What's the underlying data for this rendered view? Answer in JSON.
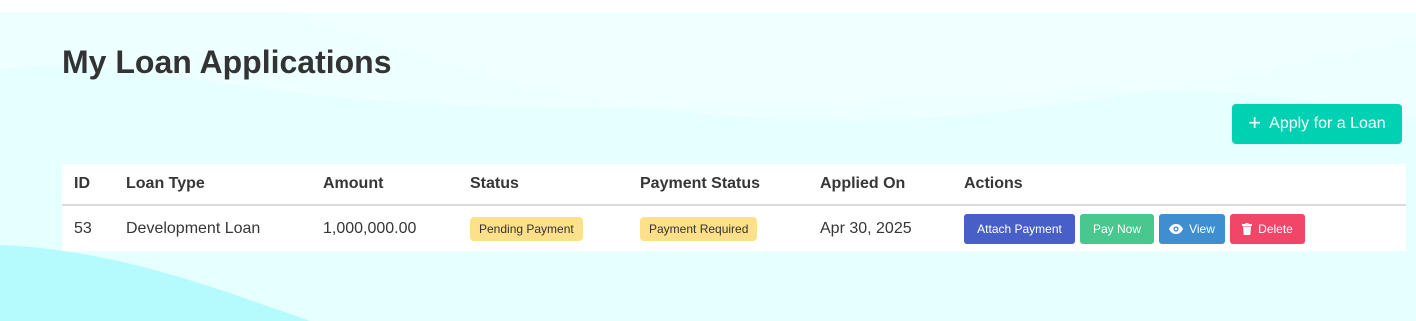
{
  "page": {
    "title": "My Loan Applications"
  },
  "apply_button": {
    "icon": "plus-icon",
    "label": "Apply for a Loan",
    "color": "#00d1b2"
  },
  "table": {
    "headers": [
      "ID",
      "Loan Type",
      "Amount",
      "Status",
      "Payment Status",
      "Applied On",
      "Actions"
    ],
    "rows": [
      {
        "id": "53",
        "loan_type": "Development Loan",
        "amount": "1,000,000.00",
        "status": "Pending Payment",
        "payment_status": "Payment Required",
        "applied_on": "Apr 30, 2025",
        "actions": {
          "attach_payment": "Attach Payment",
          "pay_now": "Pay Now",
          "view": "View",
          "delete": "Delete"
        }
      }
    ]
  },
  "colors": {
    "tag_warning": "#ffe08a",
    "attach": "#485fc7",
    "pay": "#48c78e",
    "view": "#3e8ed0",
    "delete": "#f14668"
  }
}
